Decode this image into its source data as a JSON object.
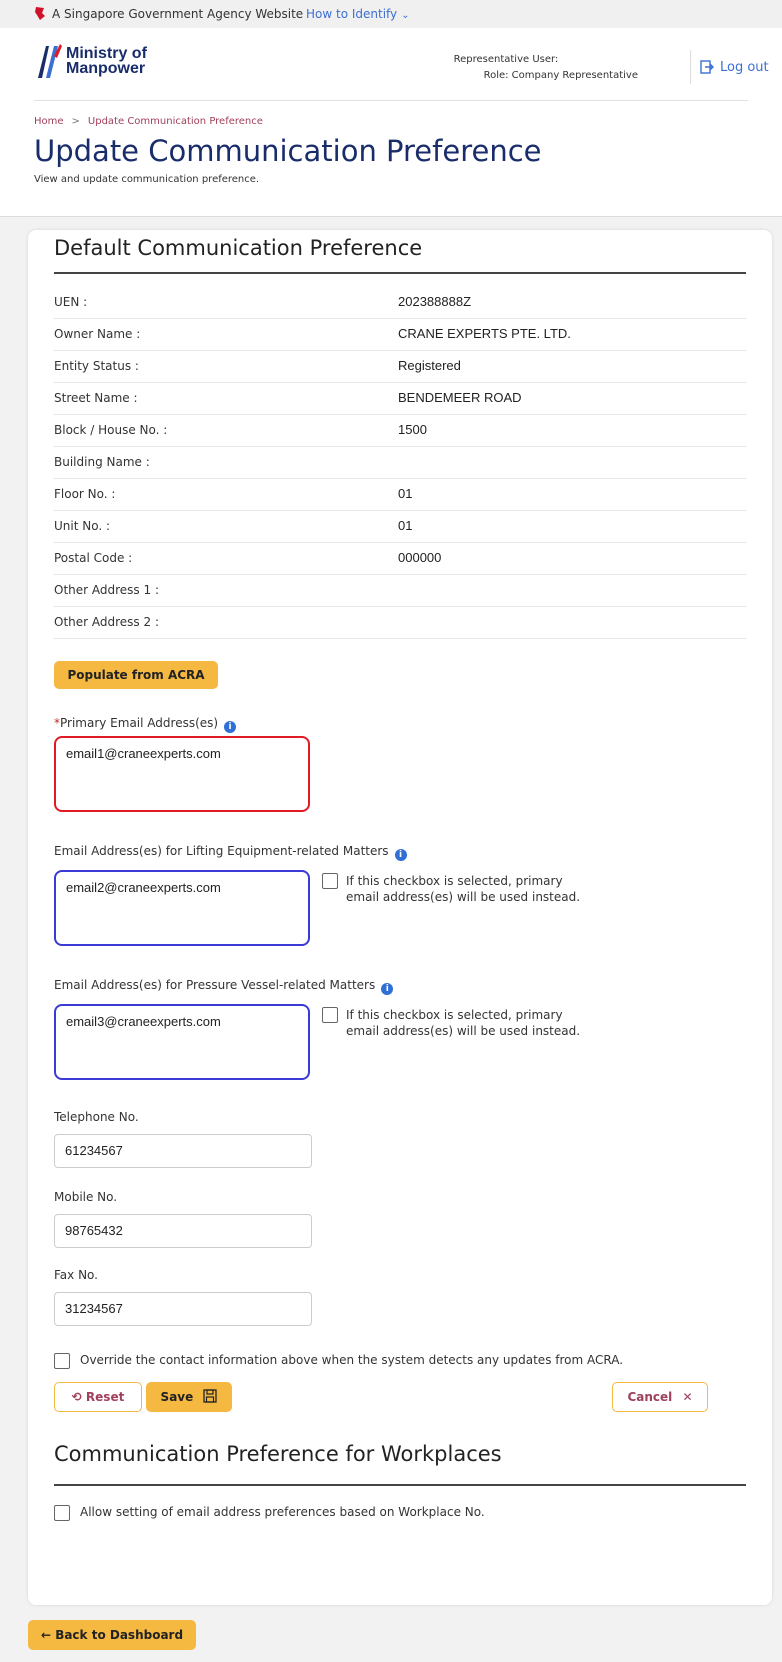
{
  "gov_banner": {
    "text": "A Singapore Government Agency Website",
    "link": "How to Identify"
  },
  "logo": {
    "line1": "Ministry of",
    "line2": "Manpower"
  },
  "user": {
    "rep_label": "Representative User:",
    "role": "Role: Company Representative"
  },
  "logout_label": "Log out",
  "breadcrumb": {
    "home": "Home",
    "current": "Update Communication Preference"
  },
  "page": {
    "title": "Update Communication Preference",
    "subtitle": "View and update communication preference."
  },
  "default_pref": {
    "title": "Default Communication Preference",
    "rows": [
      {
        "label": "UEN :",
        "value": "202388888Z"
      },
      {
        "label": "Owner Name :",
        "value": "CRANE EXPERTS PTE. LTD."
      },
      {
        "label": "Entity Status :",
        "value": "Registered"
      },
      {
        "label": "Street Name :",
        "value": "BENDEMEER ROAD"
      },
      {
        "label": "Block / House No. :",
        "value": "1500"
      },
      {
        "label": "Building Name :",
        "value": ""
      },
      {
        "label": "Floor No. :",
        "value": "01"
      },
      {
        "label": "Unit No. :",
        "value": "01"
      },
      {
        "label": "Postal Code :",
        "value": "000000"
      },
      {
        "label": "Other Address 1 :",
        "value": ""
      },
      {
        "label": "Other Address 2 :",
        "value": ""
      }
    ],
    "populate_button": "Populate from ACRA"
  },
  "emails": {
    "primary_req": "*",
    "primary_label": "Primary Email Address(es)",
    "primary_value": "email1@craneexperts.com",
    "lifting_label": "Email Address(es) for Lifting Equipment-related Matters",
    "lifting_value": "email2@craneexperts.com",
    "pressure_label": "Email Address(es) for Pressure Vessel-related Matters",
    "pressure_value": "email3@craneexperts.com",
    "checkbox_text": "If this checkbox is selected, primary email address(es) will be used instead."
  },
  "contacts": {
    "telephone_label": "Telephone No.",
    "telephone_value": "61234567",
    "mobile_label": "Mobile No.",
    "mobile_value": "98765432",
    "fax_label": "Fax No.",
    "fax_value": "31234567"
  },
  "override_text": "Override the contact information above when the system detects any updates from ACRA.",
  "buttons": {
    "reset": "Reset",
    "save": "Save",
    "cancel": "Cancel",
    "back": "Back to Dashboard"
  },
  "workplaces": {
    "title": "Communication Preference for Workplaces",
    "checkbox_text": "Allow setting of email address preferences based on Workplace No."
  },
  "colors": {
    "brand_navy": "#1a2d6b",
    "accent_yellow": "#f5b942",
    "link_blue": "#3b6fd4",
    "error_red": "#e01b24",
    "focus_blue": "#3a3ad6"
  }
}
